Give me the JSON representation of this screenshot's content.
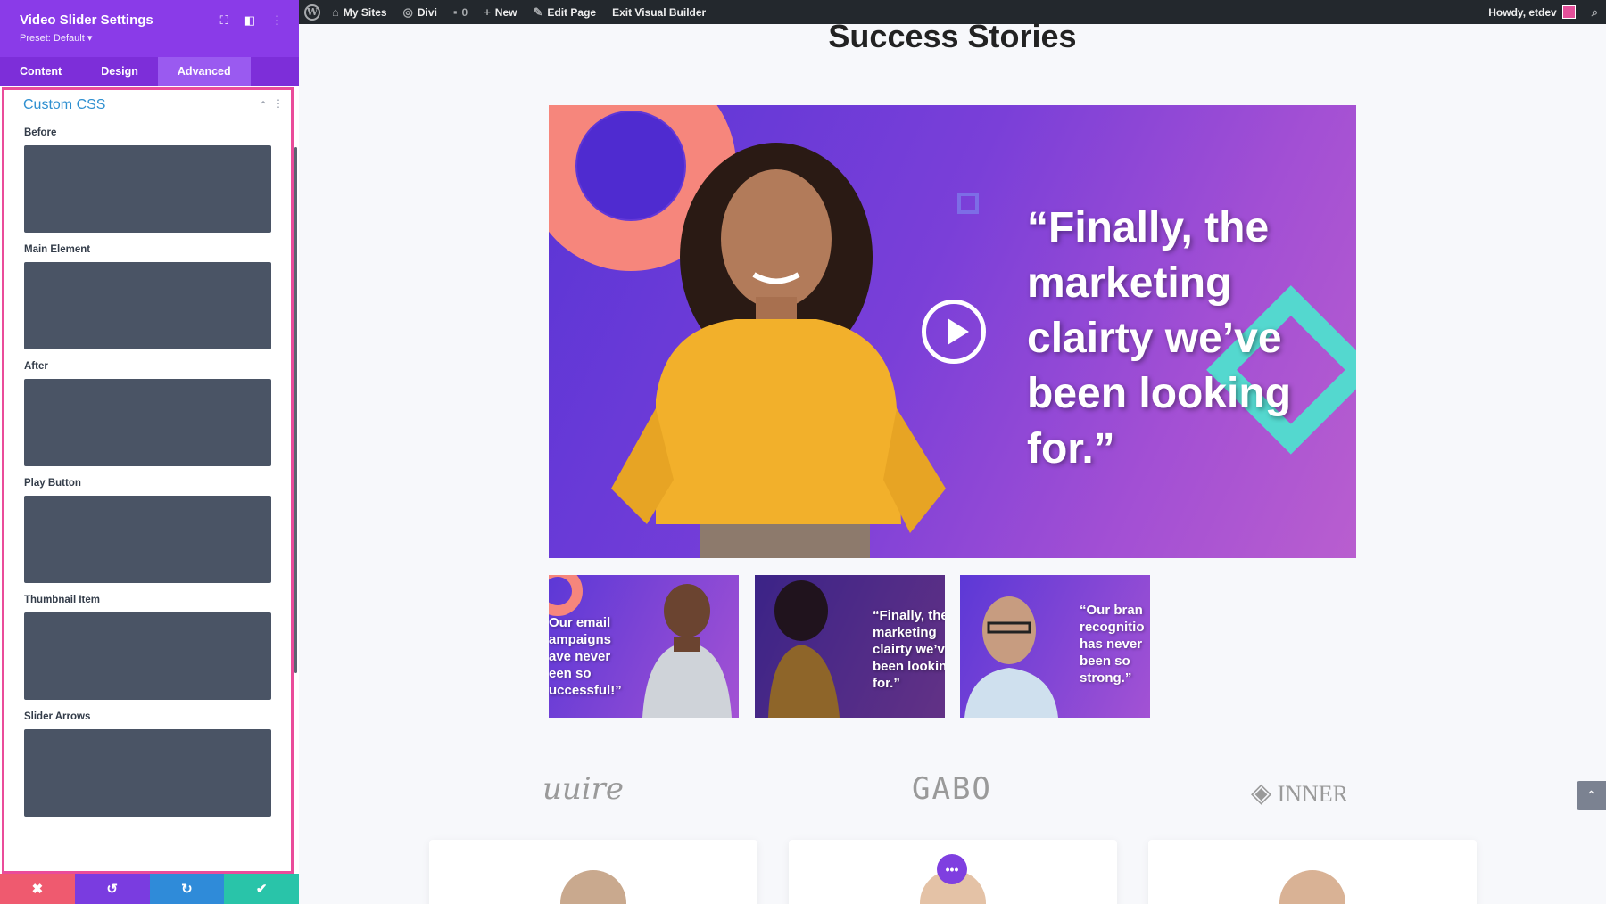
{
  "adminbar": {
    "items": [
      "My Sites",
      "Divi",
      "0",
      "New",
      "Edit Page",
      "Exit Visual Builder"
    ],
    "greeting": "Howdy, etdev"
  },
  "panel": {
    "title": "Video Slider Settings",
    "preset": "Preset: Default ▾",
    "tabs": [
      "Content",
      "Design",
      "Advanced"
    ],
    "active_tab": "Advanced",
    "section_title": "Custom CSS",
    "fields": [
      "Before",
      "Main Element",
      "After",
      "Play Button",
      "Thumbnail Item",
      "Slider Arrows"
    ],
    "footer": {
      "discard": "✖",
      "undo": "↺",
      "redo": "↻",
      "save": "✔"
    }
  },
  "page": {
    "title": "Success Stories",
    "main_quote": "“Finally, the marketing clairty we’ve been looking for.”",
    "thumbs": [
      "Our email\nampaigns\nave never\neen so\nuccessful!”",
      "“Finally, the\nmarketing\nclairty we’v\nbeen lookin\nfor.”",
      "“Our bran\nrecognitio\nhas never\nbeen so\nstrong.”"
    ],
    "logos": [
      "uuire",
      "GABO",
      "INNER"
    ]
  },
  "colors": {
    "panel_header": "#8a3be8",
    "panel_tabs": "#7d2ed9",
    "active_tab": "#9a5af0",
    "highlight_border": "#ea4c9a",
    "css_field": "#4a5465",
    "section_title": "#2e8fd0"
  },
  "icons": [
    "wordpress-icon",
    "my-sites-icon",
    "divi-icon",
    "comment-icon",
    "plus-icon",
    "edit-icon",
    "search-icon",
    "expand-icon",
    "layout-icon",
    "more-icon",
    "chevron-up-icon",
    "play-icon",
    "arrow-up-icon"
  ]
}
